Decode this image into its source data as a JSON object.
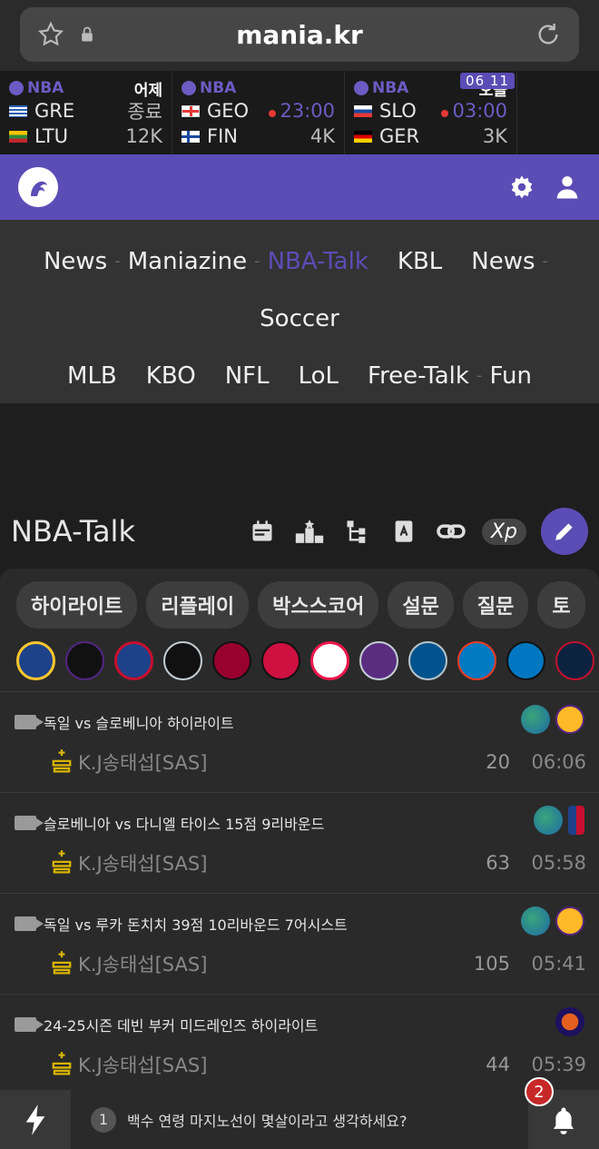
{
  "browser": {
    "url": "mania.kr"
  },
  "scores": [
    {
      "league": "NBA",
      "day": "어제",
      "teams": [
        {
          "code": "GRE",
          "val": "종료"
        },
        {
          "code": "LTU",
          "val": "12K"
        }
      ]
    },
    {
      "league": "NBA",
      "day": "",
      "teams": [
        {
          "code": "GEO",
          "time": "23:00"
        },
        {
          "code": "FIN",
          "val": "4K"
        }
      ]
    },
    {
      "league": "NBA",
      "day": "오늘",
      "date": "06 11",
      "teams": [
        {
          "code": "SLO",
          "time": "03:00"
        },
        {
          "code": "GER",
          "val": "3K"
        }
      ]
    }
  ],
  "nav": {
    "row1": [
      "News",
      "Maniazine",
      "NBA-Talk",
      "KBL",
      "News"
    ],
    "row2": [
      "Soccer"
    ],
    "row3": [
      "MLB",
      "KBO",
      "NFL",
      "LoL",
      "Free-Talk",
      "Fun"
    ]
  },
  "board": {
    "title": "NBA-Talk",
    "xp": "Xp"
  },
  "chips": [
    "하이라이트",
    "리플레이",
    "박스스코어",
    "설문",
    "질문",
    "토"
  ],
  "team_logos": [
    "GSW",
    "LAL",
    "LAC",
    "SAS",
    "MIA",
    "HOU",
    "PHI",
    "SAC",
    "DAL",
    "OKC",
    "ORL",
    "NOP"
  ],
  "posts": [
    {
      "title": "독일 vs 슬로베니아 하이라이트",
      "author": "K.J송태섭[SAS]",
      "views": "20",
      "time": "06:06"
    },
    {
      "title": "슬로베니아 vs 다니엘 타이스 15점 9리바운드",
      "author": "K.J송태섭[SAS]",
      "views": "63",
      "time": "05:58"
    },
    {
      "title": "독일 vs 루카 돈치치 39점 10리바운드 7어시스트",
      "author": "K.J송태섭[SAS]",
      "views": "105",
      "time": "05:41"
    },
    {
      "title": "24-25시즌 데빈 부커 미드레인즈 하이라이트",
      "author": "K.J송태섭[SAS]",
      "views": "44",
      "time": "05:39"
    }
  ],
  "ticker": {
    "index": "1",
    "text": "백수 연령 마지노선이 몇살이라고 생각하세요?"
  },
  "notifications": "2",
  "colors": {
    "accent": "#5b4db5",
    "live_dot": "#e53935"
  }
}
